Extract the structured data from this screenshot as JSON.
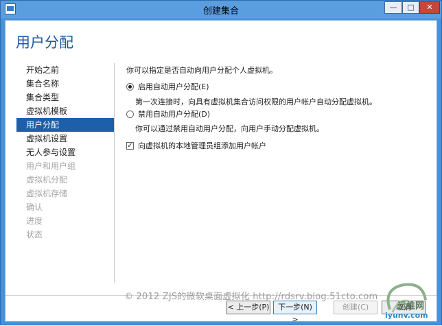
{
  "window": {
    "title": "创建集合"
  },
  "page": {
    "title": "用户分配"
  },
  "nav": {
    "items": [
      {
        "label": "开始之前",
        "state": "normal"
      },
      {
        "label": "集合名称",
        "state": "normal"
      },
      {
        "label": "集合类型",
        "state": "normal"
      },
      {
        "label": "虚拟机模板",
        "state": "normal"
      },
      {
        "label": "用户分配",
        "state": "active"
      },
      {
        "label": "虚拟机设置",
        "state": "normal"
      },
      {
        "label": "无人参与设置",
        "state": "normal"
      },
      {
        "label": "用户和用户组",
        "state": "disabled"
      },
      {
        "label": "虚拟机分配",
        "state": "disabled"
      },
      {
        "label": "虚拟机存储",
        "state": "disabled"
      },
      {
        "label": "确认",
        "state": "disabled"
      },
      {
        "label": "进度",
        "state": "disabled"
      },
      {
        "label": "状态",
        "state": "disabled"
      }
    ]
  },
  "main": {
    "intro": "你可以指定是否自动向用户分配个人虚拟机。",
    "option_auto": {
      "label": "启用自动用户分配(E)",
      "checked": true,
      "desc": "第一次连接时，向具有虚拟机集合访问权限的用户帐户自动分配虚拟机。"
    },
    "option_manual": {
      "label": "禁用自动用户分配(D)",
      "checked": false,
      "desc": "你可以通过禁用自动用户分配，向用户手动分配虚拟机。"
    },
    "checkbox_admin": {
      "label": "向虚拟机的本地管理员组添加用户帐户",
      "checked": true
    }
  },
  "buttons": {
    "prev": "< 上一步(P)",
    "next": "下一步(N) >",
    "create": "创建(C)",
    "cancel": "取消"
  },
  "watermark": {
    "text": "© 2012 ZJS的微软桌面虚拟化 http://rdsrv.blog.51cto.com"
  },
  "logo": {
    "text": "运维网",
    "sub": "iyunv.com"
  },
  "colors": {
    "accent": "#1d5fa9",
    "title": "#1a5aa0",
    "disabled": "#a5a5a5"
  }
}
